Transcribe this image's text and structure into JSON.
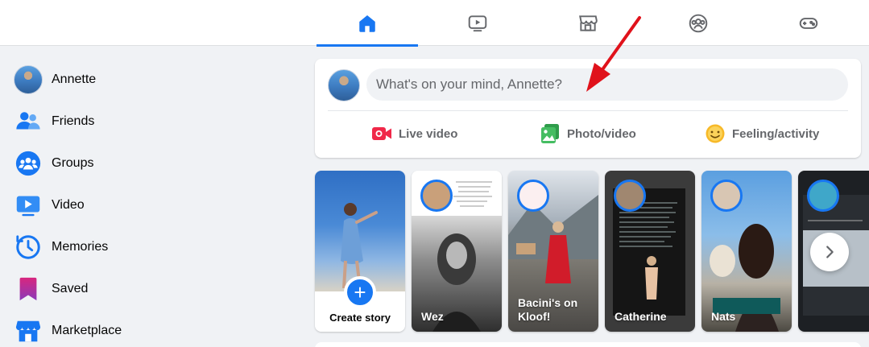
{
  "colors": {
    "accent": "#1877f2",
    "arrow": "#e0121b",
    "muted_text": "#65676b",
    "live_red": "#f02849",
    "photo_green": "#45bd62",
    "feeling_yellow": "#f7b928"
  },
  "top_nav": {
    "tabs": [
      {
        "icon": "home-icon",
        "active": true
      },
      {
        "icon": "watch-icon",
        "active": false
      },
      {
        "icon": "marketplace-icon",
        "active": false
      },
      {
        "icon": "groups-icon",
        "active": false
      },
      {
        "icon": "gaming-icon",
        "active": false
      }
    ]
  },
  "sidebar": {
    "items": [
      {
        "label": "Annette",
        "icon": "profile-avatar"
      },
      {
        "label": "Friends",
        "icon": "friends-icon"
      },
      {
        "label": "Groups",
        "icon": "groups-icon"
      },
      {
        "label": "Video",
        "icon": "video-icon"
      },
      {
        "label": "Memories",
        "icon": "memories-icon"
      },
      {
        "label": "Saved",
        "icon": "saved-icon"
      },
      {
        "label": "Marketplace",
        "icon": "marketplace-icon"
      }
    ]
  },
  "composer": {
    "placeholder": "What's on your mind, Annette?",
    "actions": [
      {
        "label": "Live video",
        "icon": "live-video-icon"
      },
      {
        "label": "Photo/video",
        "icon": "photo-video-icon"
      },
      {
        "label": "Feeling/activity",
        "icon": "feeling-activity-icon"
      }
    ]
  },
  "stories": {
    "create_label": "Create story",
    "items": [
      {
        "name": "Wez"
      },
      {
        "name": "Bacini's on Kloof!"
      },
      {
        "name": "Catherine"
      },
      {
        "name": "Nats"
      },
      {
        "name": ""
      }
    ],
    "next_icon": "chevron-right-icon"
  }
}
